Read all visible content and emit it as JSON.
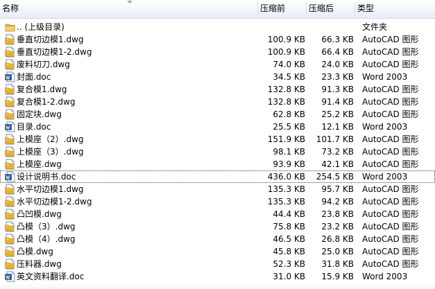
{
  "columns": {
    "name": "名称",
    "compressed_before": "压缩前",
    "compressed_after": "压缩后",
    "type": "类型"
  },
  "rows": [
    {
      "name": ".. (上级目录)",
      "before": "",
      "after": "",
      "type": "文件夹",
      "icon": "folder-icon"
    },
    {
      "name": "垂直切边模1.dwg",
      "before": "100.9 KB",
      "after": "66.3 KB",
      "type": "AutoCAD 图形",
      "icon": "dwg-file-icon"
    },
    {
      "name": "垂直切边模1-2.dwg",
      "before": "100.9 KB",
      "after": "66.4 KB",
      "type": "AutoCAD 图形",
      "icon": "dwg-file-icon"
    },
    {
      "name": "废料切刀.dwg",
      "before": "74.0 KB",
      "after": "24.0 KB",
      "type": "AutoCAD 图形",
      "icon": "dwg-file-icon"
    },
    {
      "name": "封面.doc",
      "before": "34.5 KB",
      "after": "23.3 KB",
      "type": "Word 2003",
      "icon": "word-file-icon"
    },
    {
      "name": "复合模1.dwg",
      "before": "132.8 KB",
      "after": "91.3 KB",
      "type": "AutoCAD 图形",
      "icon": "dwg-file-icon"
    },
    {
      "name": "复合模1-2.dwg",
      "before": "132.8 KB",
      "after": "91.4 KB",
      "type": "AutoCAD 图形",
      "icon": "dwg-file-icon"
    },
    {
      "name": "固定块.dwg",
      "before": "62.8 KB",
      "after": "25.2 KB",
      "type": "AutoCAD 图形",
      "icon": "dwg-file-icon"
    },
    {
      "name": "目录.doc",
      "before": "25.5 KB",
      "after": "12.1 KB",
      "type": "Word 2003",
      "icon": "word-file-icon"
    },
    {
      "name": "上模座（2）.dwg",
      "before": "151.9 KB",
      "after": "101.7 KB",
      "type": "AutoCAD 图形",
      "icon": "dwg-file-icon"
    },
    {
      "name": "上模座（3）.dwg",
      "before": "98.1 KB",
      "after": "73.2 KB",
      "type": "AutoCAD 图形",
      "icon": "dwg-file-icon"
    },
    {
      "name": "上模座.dwg",
      "before": "93.9 KB",
      "after": "42.1 KB",
      "type": "AutoCAD 图形",
      "icon": "dwg-file-icon"
    },
    {
      "name": "设计说明书.doc",
      "before": "436.0 KB",
      "after": "254.5 KB",
      "type": "Word 2003",
      "icon": "word-file-icon",
      "focused": true
    },
    {
      "name": "水平切边模1.dwg",
      "before": "135.3 KB",
      "after": "95.7 KB",
      "type": "AutoCAD 图形",
      "icon": "dwg-file-icon"
    },
    {
      "name": "水平切边模1-2.dwg",
      "before": "135.3 KB",
      "after": "94.2 KB",
      "type": "AutoCAD 图形",
      "icon": "dwg-file-icon"
    },
    {
      "name": "凸凹模.dwg",
      "before": "44.4 KB",
      "after": "23.8 KB",
      "type": "AutoCAD 图形",
      "icon": "dwg-file-icon"
    },
    {
      "name": "凸模（3）.dwg",
      "before": "75.8 KB",
      "after": "23.2 KB",
      "type": "AutoCAD 图形",
      "icon": "dwg-file-icon"
    },
    {
      "name": "凸模（4）.dwg",
      "before": "46.5 KB",
      "after": "26.8 KB",
      "type": "AutoCAD 图形",
      "icon": "dwg-file-icon"
    },
    {
      "name": "凸模.dwg",
      "before": "45.8 KB",
      "after": "25.0 KB",
      "type": "AutoCAD 图形",
      "icon": "dwg-file-icon"
    },
    {
      "name": "压料器.dwg",
      "before": "52.3 KB",
      "after": "31.8 KB",
      "type": "AutoCAD 图形",
      "icon": "dwg-file-icon"
    },
    {
      "name": "英文资料翻译.doc",
      "before": "31.0 KB",
      "after": "15.9 KB",
      "type": "Word 2003",
      "icon": "word-file-icon"
    }
  ]
}
